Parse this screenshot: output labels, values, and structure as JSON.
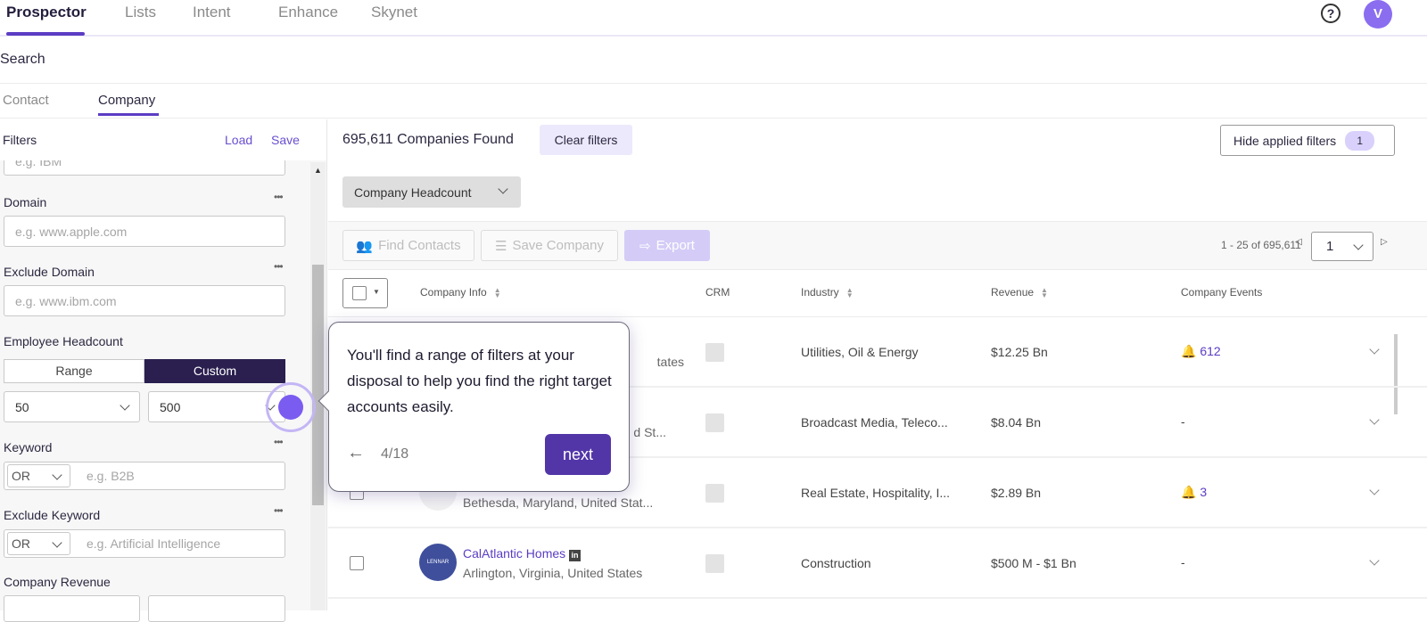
{
  "topnav": {
    "tabs": [
      "Prospector",
      "Lists",
      "Intent",
      "Enhance",
      "Skynet"
    ],
    "active": "Prospector",
    "help_icon": "question-circle-icon",
    "avatar": "V"
  },
  "page_title": "Search",
  "subtabs": {
    "items": [
      "Contact",
      "Company"
    ],
    "active": "Company"
  },
  "filters": {
    "title": "Filters",
    "load": "Load",
    "save": "Save",
    "top_placeholder": "e.g. IBM",
    "domain": {
      "label": "Domain",
      "placeholder": "e.g. www.apple.com"
    },
    "exclude_domain": {
      "label": "Exclude Domain",
      "placeholder": "e.g. www.ibm.com"
    },
    "headcount": {
      "label": "Employee Headcount",
      "range": "Range",
      "custom": "Custom",
      "active": "Custom",
      "min": "50",
      "max": "500"
    },
    "keyword": {
      "label": "Keyword",
      "operator": "OR",
      "placeholder": "e.g. B2B"
    },
    "exclude_keyword": {
      "label": "Exclude Keyword",
      "operator": "OR",
      "placeholder": "e.g. Artificial Intelligence"
    },
    "revenue": {
      "label": "Company Revenue"
    }
  },
  "results": {
    "count_text": "695,611 Companies Found",
    "clear_filters": "Clear filters",
    "hide_filters": "Hide applied filters",
    "applied_count": "1",
    "chip": "Company Headcount"
  },
  "toolbar": {
    "find_contacts": "Find Contacts",
    "save_company": "Save Company",
    "export": "Export",
    "range_text": "1 - 25 of 695,611",
    "page": "1"
  },
  "table": {
    "headers": {
      "company": "Company Info",
      "crm": "CRM",
      "industry": "Industry",
      "revenue": "Revenue",
      "events": "Company Events"
    },
    "rows": [
      {
        "name": "",
        "location": "tates",
        "industry": "Utilities, Oil & Energy",
        "revenue": "$12.25 Bn",
        "events": "612"
      },
      {
        "name": "",
        "location": "d St...",
        "industry": "Broadcast Media, Teleco...",
        "revenue": "$8.04 Bn",
        "events": "-"
      },
      {
        "name": "",
        "location": "Bethesda, Maryland, United Stat...",
        "industry": "Real Estate, Hospitality, I...",
        "revenue": "$2.89 Bn",
        "events": "3"
      },
      {
        "name": "CalAtlantic Homes",
        "location": "Arlington, Virginia, United States",
        "industry": "Construction",
        "revenue": "$500 M - $1 Bn",
        "events": "-",
        "logo": "LENNAR"
      }
    ]
  },
  "tour": {
    "text": "You'll find a range of filters at your disposal to help you find the right target accounts easily.",
    "step": "4/18",
    "next": "next"
  },
  "colors": {
    "accent": "#5b3cc4",
    "dark": "#2a1f4f",
    "beacon": "#7b5cf0",
    "export_bg": "#d4ccf7",
    "clear_bg": "#ede9fc"
  }
}
